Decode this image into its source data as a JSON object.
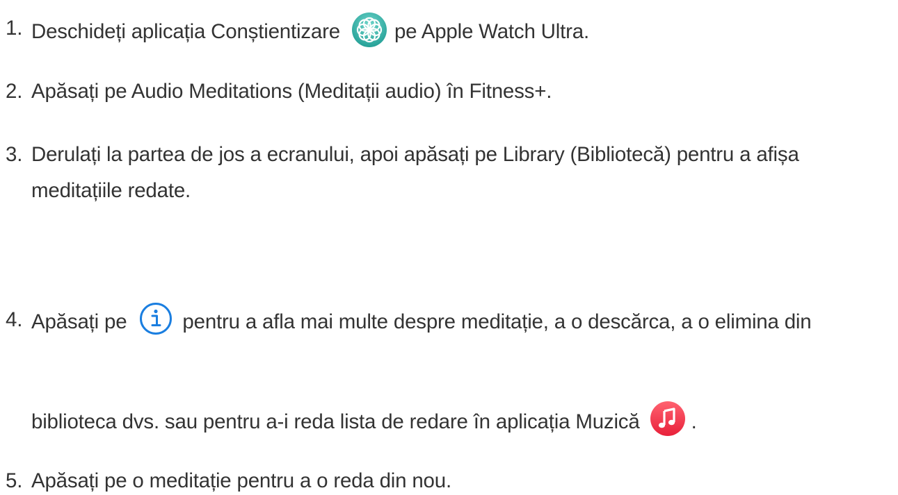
{
  "steps": [
    {
      "number": "1.",
      "before_icon": "Deschideți aplicația Conștientizare",
      "icon": "mindfulness-app-icon",
      "after_icon": " pe Apple Watch Ultra."
    },
    {
      "number": "2.",
      "text": "Apăsați pe Audio Meditations (Meditații audio) în Fitness+."
    },
    {
      "number": "3.",
      "line1": "Derulați la partea de jos a ecranului, apoi apăsați pe Library (Bibliotecă) pentru a afișa",
      "line2": "meditațiile redate."
    },
    {
      "number": "4.",
      "before_icon": "Apăsați pe",
      "icon": "info-icon",
      "after_icon": "pentru a afla mai multe despre meditație, a o descărca, a o elimina din",
      "line2_before_icon": "biblioteca dvs. sau pentru a-i reda lista de redare în aplicația Muzică",
      "line2_icon": "music-app-icon",
      "line2_after_icon": "."
    },
    {
      "number": "5.",
      "text": "Apăsați pe o meditație pentru a o reda din nou."
    }
  ],
  "colors": {
    "text": "#333333",
    "mindfulness_icon": "#3fbcb2",
    "info_icon": "#1a7ee0",
    "music_icon": "#f23a4c"
  }
}
